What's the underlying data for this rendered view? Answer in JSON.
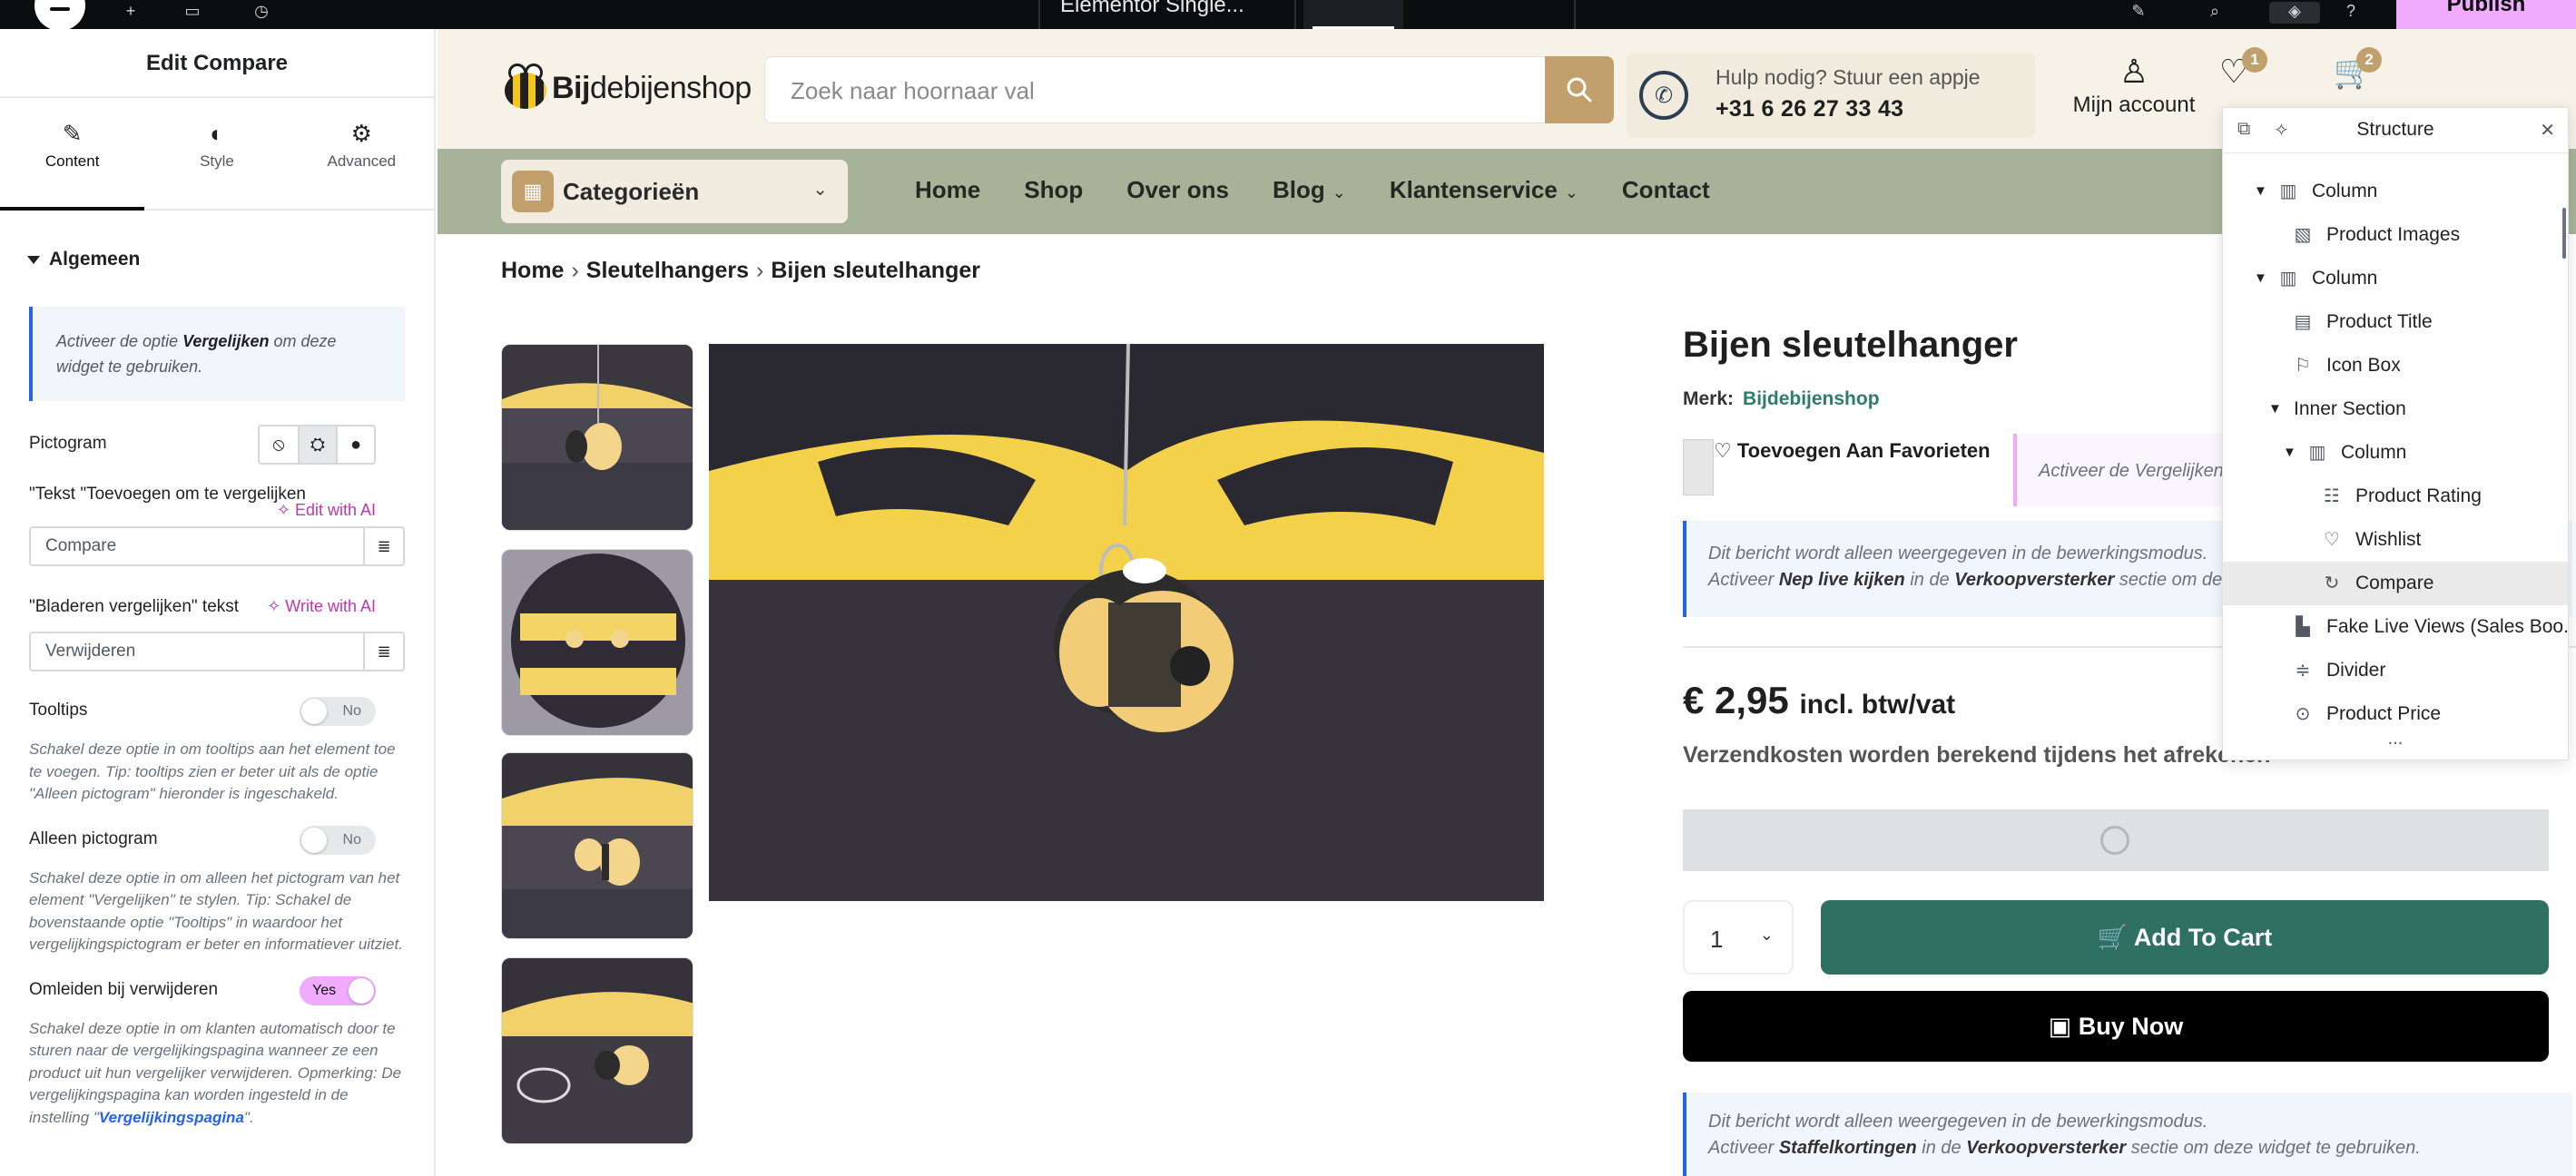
{
  "topbar": {
    "document_title": "Elementor Single...",
    "publish_label": "Publish"
  },
  "panel": {
    "title": "Edit Compare",
    "tabs": [
      {
        "label": "Content",
        "icon": "pencil-icon"
      },
      {
        "label": "Style",
        "icon": "half-circle-icon"
      },
      {
        "label": "Advanced",
        "icon": "gear-icon"
      }
    ],
    "section_title": "Algemeen",
    "notice": {
      "before": "Activeer de optie ",
      "bold": "Vergelijken",
      "after": " om deze widget te gebruiken."
    },
    "pictogram_label": "Pictogram",
    "add_text_label": "\"Tekst \"Toevoegen om te vergelijken",
    "edit_ai_label": "Edit with AI",
    "add_text_value": "Compare",
    "browse_text_label": "\"Bladeren vergelijken\" tekst",
    "write_ai_label": "Write with AI",
    "browse_text_value": "Verwijderen",
    "tooltips": {
      "label": "Tooltips",
      "value": "No",
      "help": "Schakel deze optie in om tooltips aan het element toe te voegen. Tip: tooltips zien er beter uit als de optie \"Alleen pictogram\" hieronder is ingeschakeld."
    },
    "icon_only": {
      "label": "Alleen pictogram",
      "value": "No",
      "help": "Schakel deze optie in om alleen het pictogram van het element \"Vergelijken\" te stylen. Tip: Schakel de bovenstaande optie \"Tooltips\" in waardoor het vergelijkingspictogram er beter en informatiever uitziet."
    },
    "redirect": {
      "label": "Omleiden bij verwijderen",
      "value": "Yes",
      "help_before": "Schakel deze optie in om klanten automatisch door te sturen naar de vergelijkingspagina wanneer ze een product uit hun vergelijker verwijderen. Opmerking: De vergelijkingspagina kan worden ingesteld in de instelling \"",
      "help_link": "Vergelijkingspagina",
      "help_after": "\"."
    }
  },
  "site": {
    "logo_bold": "Bij",
    "logo_rest": "debijenshop",
    "search_placeholder": "Zoek naar hoornaar val",
    "help_line1": "Hulp nodig? Stuur een appje",
    "help_phone": "+31 6 26 27 33 43",
    "account_label": "Mijn account",
    "wishlist_count": "1",
    "cart_count": "2",
    "categories_label": "Categorieën",
    "nav": [
      "Home",
      "Shop",
      "Over ons",
      "Blog",
      "Klantenservice",
      "Contact"
    ],
    "breadcrumb": [
      "Home",
      "Sleutelhangers",
      "Bijen sleutelhanger"
    ],
    "product": {
      "name": "Bijen sleutelhanger",
      "brand_label": "Merk:",
      "brand": "Bijdebijenshop",
      "favorite_label": "Toevoegen Aan Favorieten",
      "compare_notice": "Activeer de Vergelijken",
      "note1_line1": "Dit bericht wordt alleen weergegeven in de bewerkingsmodus.",
      "note1_pre": "Activeer ",
      "note1_b1": "Nep live kijken",
      "note1_mid": " in de ",
      "note1_b2": "Verkoopversterker",
      "note1_post": " sectie om deze widget te gebruiken.",
      "price": "€ 2,95",
      "price_suffix": "incl. btw/vat",
      "shipping": "Verzendkosten worden berekend tijdens het afrekenen",
      "quantity": "1",
      "add_to_cart": "Add To Cart",
      "buy_now": "Buy Now",
      "note2_line1": "Dit bericht wordt alleen weergegeven in de bewerkingsmodus.",
      "note2_pre": "Activeer ",
      "note2_b1": "Staffelkortingen",
      "note2_mid": " in de ",
      "note2_b2": "Verkoopversterker",
      "note2_post": " sectie om deze widget te gebruiken."
    }
  },
  "structure": {
    "title": "Structure",
    "items": [
      {
        "label": "Column",
        "icon": "column-icon",
        "caret": true
      },
      {
        "label": "Product Images",
        "icon": "image-icon",
        "caret": false
      },
      {
        "label": "Column",
        "icon": "column-icon",
        "caret": true
      },
      {
        "label": "Product Title",
        "icon": "title-icon",
        "caret": false
      },
      {
        "label": "Icon Box",
        "icon": "flag-icon",
        "caret": false
      },
      {
        "label": "Inner Section",
        "icon": "",
        "caret": true
      },
      {
        "label": "Column",
        "icon": "column-icon",
        "caret": true
      },
      {
        "label": "Product Rating",
        "icon": "rating-icon",
        "caret": false
      },
      {
        "label": "Wishlist",
        "icon": "heart-icon",
        "caret": false
      },
      {
        "label": "Compare",
        "icon": "refresh-icon",
        "caret": false,
        "selected": true
      },
      {
        "label": "Fake Live Views (Sales Boo...",
        "icon": "chart-icon",
        "caret": false
      },
      {
        "label": "Divider",
        "icon": "divider-icon",
        "caret": false
      },
      {
        "label": "Product Price",
        "icon": "price-icon",
        "caret": false
      }
    ],
    "more": "..."
  }
}
